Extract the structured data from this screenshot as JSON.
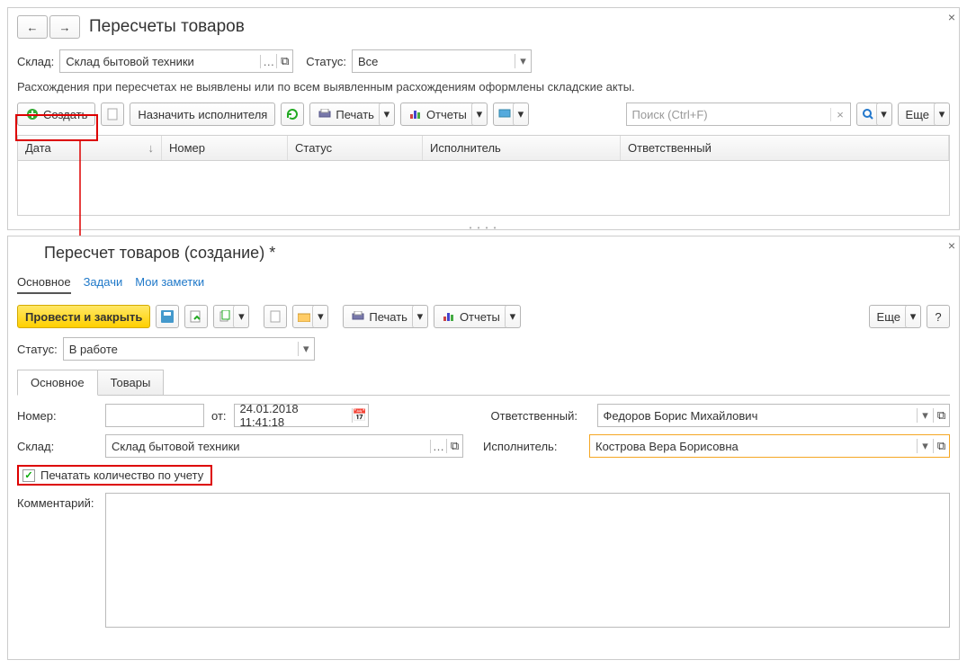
{
  "top": {
    "title": "Пересчеты товаров",
    "warehouse_label": "Склад:",
    "warehouse_value": "Склад бытовой техники",
    "status_label": "Статус:",
    "status_value": "Все",
    "hint": "Расхождения при пересчетах не выявлены или по всем выявленным расхождениям оформлены складские акты.",
    "create": "Создать",
    "assign": "Назначить исполнителя",
    "print": "Печать",
    "reports": "Отчеты",
    "search_ph": "Поиск (Ctrl+F)",
    "more": "Еще",
    "cols": {
      "date": "Дата",
      "number": "Номер",
      "status": "Статус",
      "executor": "Исполнитель",
      "responsible": "Ответственный"
    }
  },
  "bot": {
    "title": "Пересчет товаров (создание) *",
    "tabs": {
      "main": "Основное",
      "tasks": "Задачи",
      "notes": "Мои заметки"
    },
    "post_close": "Провести и закрыть",
    "print": "Печать",
    "reports": "Отчеты",
    "more": "Еще",
    "help": "?",
    "status_label": "Статус:",
    "status_value": "В работе",
    "subtabs": {
      "main": "Основное",
      "goods": "Товары"
    },
    "form": {
      "number_label": "Номер:",
      "date_label": "от:",
      "date_value": "24.01.2018 11:41:18",
      "resp_label": "Ответственный:",
      "resp_value": "Федоров Борис Михайлович",
      "wh_label": "Склад:",
      "wh_value": "Склад бытовой техники",
      "exec_label": "Исполнитель:",
      "exec_value": "Кострова Вера Борисовна",
      "print_qty": "Печатать количество по учету",
      "comment_label": "Комментарий:"
    }
  }
}
